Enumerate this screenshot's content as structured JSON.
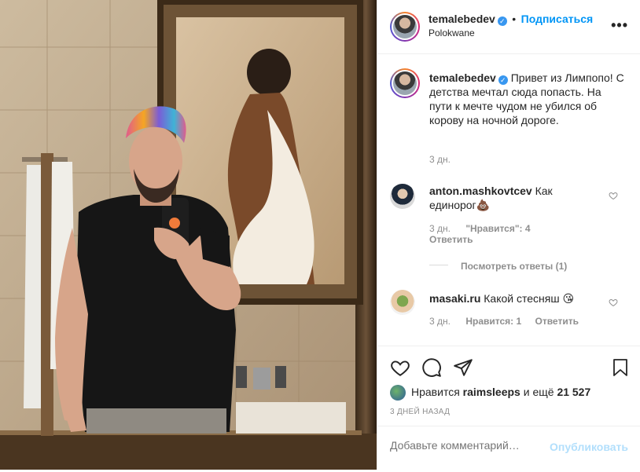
{
  "header": {
    "username": "temalebedev",
    "dot": "•",
    "follow_label": "Подписаться",
    "location": "Polokwane",
    "more_icon": "more-dots-icon"
  },
  "caption": {
    "username": "temalebedev",
    "text": "Привет из Лимпопо! С детства мечтал сюда попасть. На пути к мечте чудом не убился об корову на ночной дороге.",
    "time": "3 дн."
  },
  "comments": [
    {
      "username": "anton.mashkovtcev",
      "text": "Как единорог💩",
      "time": "3 дн.",
      "likes": "\"Нравится\": 4",
      "reply": "Ответить",
      "view_replies": "Посмотреть ответы (1)"
    },
    {
      "username": "masaki.ru",
      "text": "Какой стесняш 😘",
      "time": "3 дн.",
      "likes": "Нравится: 1",
      "reply": "Ответить"
    }
  ],
  "likes": {
    "prefix": "Нравится",
    "user": "raimsleeps",
    "middle": "и ещё",
    "count": "21 527"
  },
  "timestamp": "3 ДНЕЙ НАЗАД",
  "add_comment": {
    "placeholder": "Добавьте комментарий…",
    "post_label": "Опубликовать"
  },
  "colors": {
    "accent": "#0095f6",
    "muted": "#8e8e8e",
    "post_disabled": "#b2dffc",
    "verified": "#3897f0"
  }
}
